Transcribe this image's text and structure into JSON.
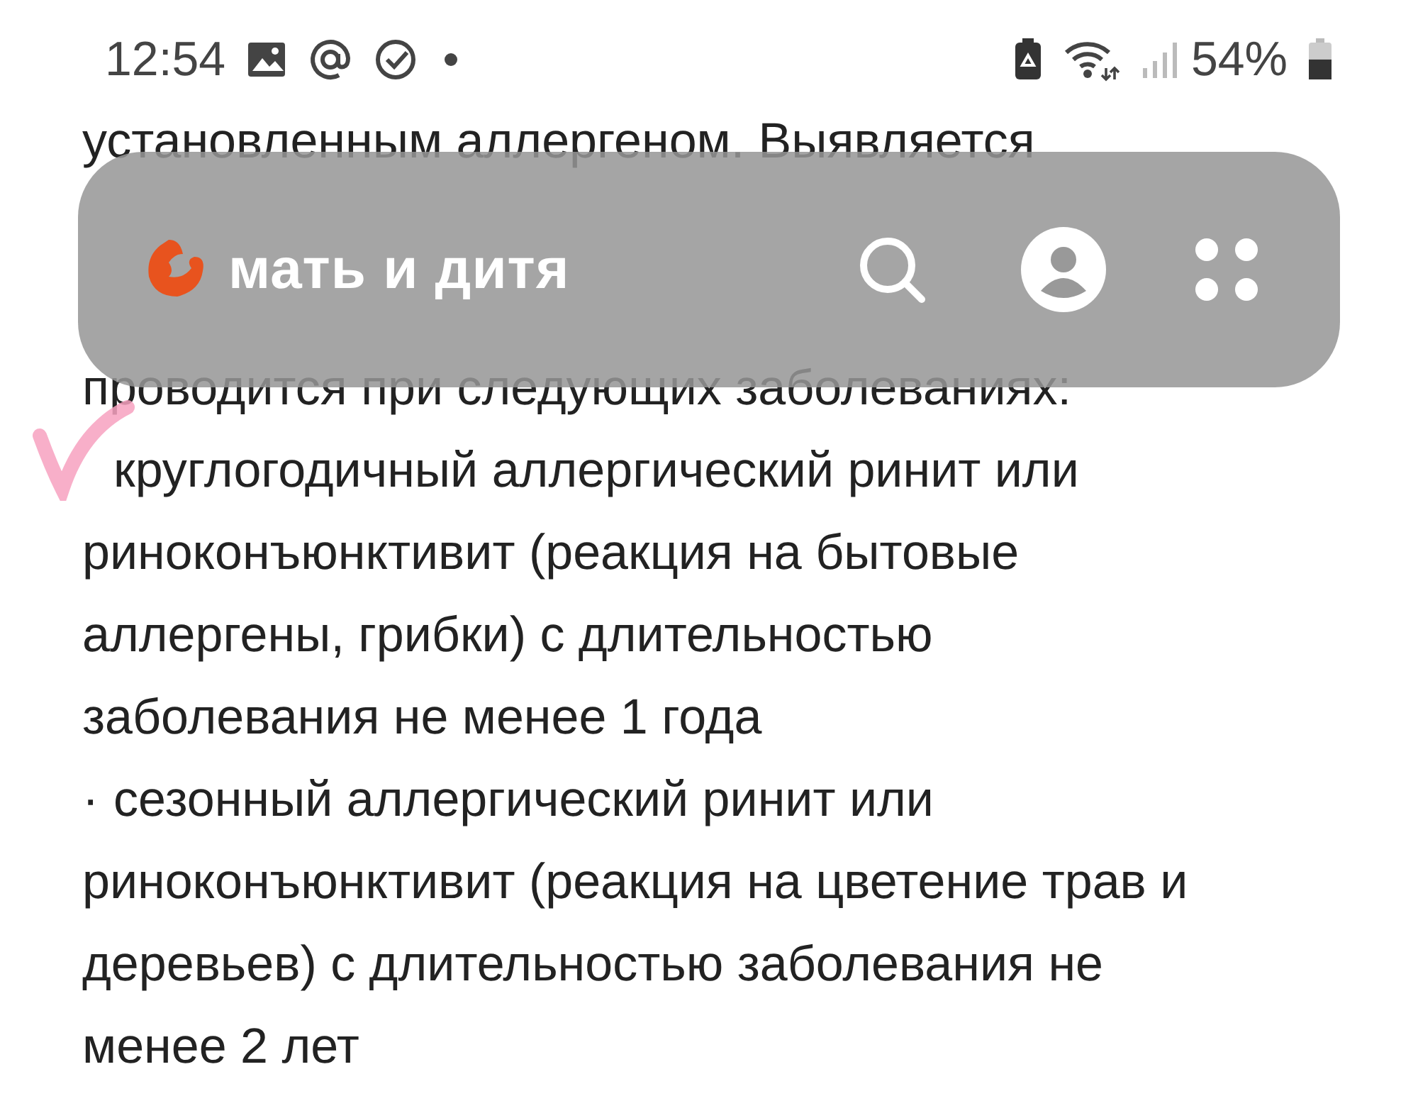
{
  "status_bar": {
    "time": "12:54",
    "battery_text": "54%",
    "battery": {
      "level": 0.54
    }
  },
  "article": {
    "lead_lines": [
      "установленным аллергеном. Выявляется"
    ],
    "partly_hidden_line": "проводится при следующих заболеваниях:",
    "items": [
      {
        "lines": [
          "круглогодичный аллергический ринит или",
          "риноконъюнктивит (реакция на бытовые",
          "аллергены, грибки) с длительностью",
          "заболевания не менее 1 года"
        ],
        "annotated": true
      },
      {
        "marker": "·",
        "lines": [
          "сезонный аллергический ринит или",
          "риноконъюнктивит (реакция на цветение трав и",
          "деревьев) с длительностью заболевания не",
          "менее 2 лет"
        ],
        "annotated": false
      }
    ]
  },
  "header": {
    "logo_text": "мать и дитя"
  }
}
